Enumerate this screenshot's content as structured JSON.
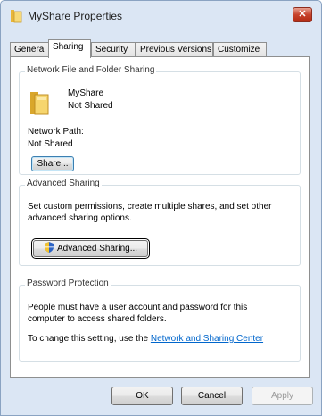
{
  "window": {
    "title": "MyShare Properties",
    "close_label": "✕"
  },
  "tabs": [
    "General",
    "Sharing",
    "Security",
    "Previous Versions",
    "Customize"
  ],
  "network_sharing": {
    "group_title": "Network File and Folder Sharing",
    "folder_name": "MyShare",
    "status": "Not Shared",
    "path_label": "Network Path:",
    "path_value": "Not Shared",
    "share_button": "Share..."
  },
  "advanced_sharing": {
    "group_title": "Advanced Sharing",
    "description_line1": "Set custom permissions, create multiple shares, and set other",
    "description_line2": "advanced sharing options.",
    "button": "Advanced Sharing..."
  },
  "password_protection": {
    "group_title": "Password Protection",
    "line1": "People must have a user account and password for this",
    "line2": "computer to access shared folders.",
    "line3_prefix": "To change this setting, use the ",
    "link": "Network and Sharing Center"
  },
  "footer": {
    "ok": "OK",
    "cancel": "Cancel",
    "apply": "Apply"
  },
  "icons": {
    "folder": "folder-icon",
    "shield": "uac-shield-icon",
    "title": "folder-title-icon"
  }
}
